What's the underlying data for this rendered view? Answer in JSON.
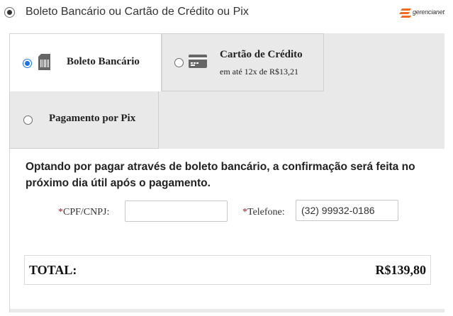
{
  "header": {
    "title": "Boleto Bancário ou Cartão de Crédito ou Pix",
    "logo_text": "gerencianet",
    "brand_color": "#f26b21"
  },
  "tabs": {
    "boleto": {
      "label": "Boleto Bancário",
      "selected": true,
      "icon": "barcode-icon"
    },
    "cartao": {
      "label": "Cartão de Crédito",
      "sub": "em até 12x de R$13,21",
      "selected": false,
      "icon": "credit-card-icon"
    },
    "pix": {
      "label": "Pagamento por Pix",
      "selected": false
    }
  },
  "content": {
    "info": "Optando por pagar através de boleto bancário, a confirmação será feita no próximo dia útil após o pagamento.",
    "cpf": {
      "required_mark": "*",
      "label": "CPF/CNPJ:",
      "value": ""
    },
    "telefone": {
      "required_mark": "*",
      "label": "Telefone:",
      "value": "(32) 99932-0186"
    }
  },
  "total": {
    "label": "TOTAL:",
    "value": "R$139,80"
  }
}
